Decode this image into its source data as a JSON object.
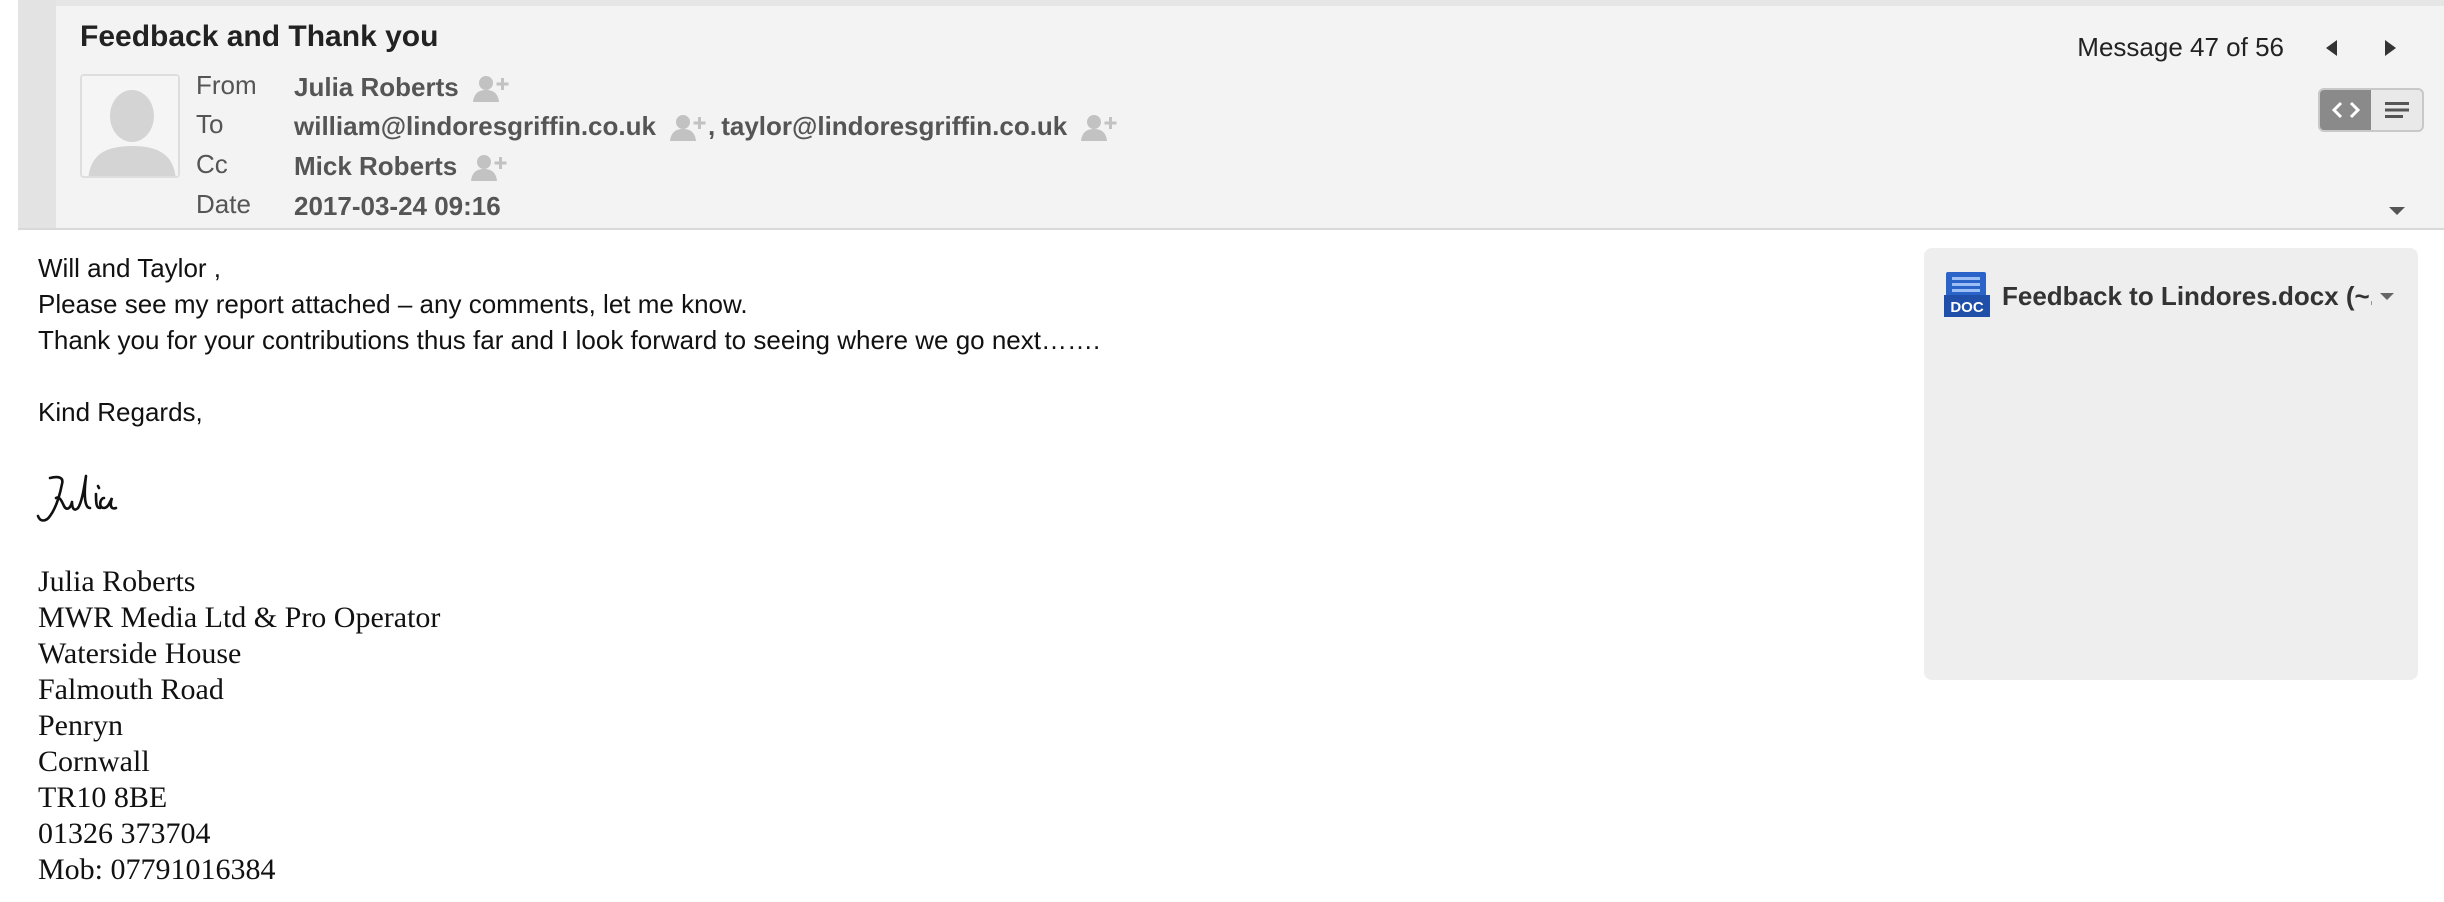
{
  "header": {
    "subject": "Feedback and Thank you",
    "message_counter": "Message 47 of 56",
    "from_label": "From",
    "from_value": "Julia Roberts",
    "to_label": "To",
    "to_values": [
      "william@lindoresgriffin.co.uk",
      "taylor@lindoresgriffin.co.uk"
    ],
    "to_separator": ",",
    "cc_label": "Cc",
    "cc_value": "Mick Roberts",
    "date_label": "Date",
    "date_value": "2017-03-24 09:16"
  },
  "body": {
    "lines": [
      "Will and Taylor ,",
      "Please see my report attached – any comments, let me know.",
      "Thank you for your contributions thus far and I look forward to seeing where we go next……."
    ],
    "closing": "Kind Regards,",
    "signature_script": "Julia",
    "signature_block": [
      "Julia Roberts",
      "MWR Media Ltd & Pro Operator",
      "Waterside House",
      "Falmouth Road",
      "Penryn",
      "Cornwall",
      "TR10 8BE",
      "01326 373704",
      "Mob: 07791016384"
    ]
  },
  "attachment": {
    "name": "Feedback to Lindores.docx (~...",
    "icon_label": "DOC"
  },
  "icons": {
    "person_add": "person-add-icon",
    "prev": "arrow-left-icon",
    "next": "arrow-right-icon",
    "html_view": "code-view-icon",
    "plain_view": "text-view-icon",
    "expand": "chevron-down-icon",
    "doc": "doc-file-icon"
  },
  "colors": {
    "header_bg": "#f3f3f3",
    "attachment_panel_bg": "#eeeeee",
    "doc_icon_blue": "#2a64c8",
    "active_toggle": "#8a8a8a"
  }
}
